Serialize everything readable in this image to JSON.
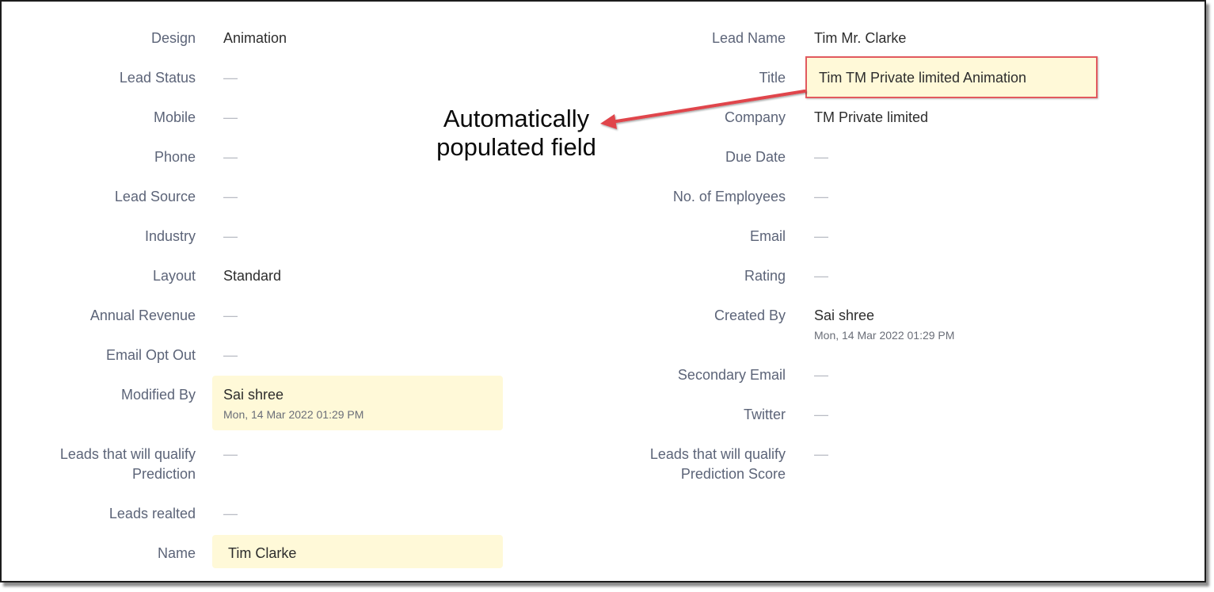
{
  "left_fields": [
    {
      "label": "Design",
      "value": "Animation"
    },
    {
      "label": "Lead Status",
      "value": "—"
    },
    {
      "label": "Mobile",
      "value": "—"
    },
    {
      "label": "Phone",
      "value": "—"
    },
    {
      "label": "Lead Source",
      "value": "—"
    },
    {
      "label": "Industry",
      "value": "—"
    },
    {
      "label": "Layout",
      "value": "Standard"
    },
    {
      "label": "Annual Revenue",
      "value": "—"
    },
    {
      "label": "Email Opt Out",
      "value": "—"
    },
    {
      "label": "Modified By",
      "value": "Sai shree",
      "sub": "Mon, 14 Mar 2022 01:29 PM"
    },
    {
      "label_line1": "Leads that will qualify",
      "label_line2": "Prediction",
      "value": "—"
    },
    {
      "label": "Leads realted",
      "value": "—"
    },
    {
      "label": "Name",
      "value": "Tim Clarke"
    }
  ],
  "right_fields": [
    {
      "label": "Lead Name",
      "value": "Tim Mr. Clarke"
    },
    {
      "label": "Title",
      "value": "Tim TM Private limited Animation"
    },
    {
      "label": "Company",
      "value": "TM Private limited"
    },
    {
      "label": "Due Date",
      "value": "—"
    },
    {
      "label": "No. of Employees",
      "value": "—"
    },
    {
      "label": "Email",
      "value": "—"
    },
    {
      "label": "Rating",
      "value": "—"
    },
    {
      "label": "Created By",
      "value": "Sai shree",
      "sub": "Mon, 14 Mar 2022 01:29 PM"
    },
    {
      "label": "Secondary Email",
      "value": "—"
    },
    {
      "label": "Twitter",
      "value": "—"
    },
    {
      "label_line1": "Leads that will qualify",
      "label_line2": "Prediction Score",
      "value": "—"
    }
  ],
  "annotation": {
    "line1": "Automatically",
    "line2": "populated field",
    "arrow_color": "#e0454b"
  },
  "colors": {
    "highlight": "#fff9d8",
    "highlight_border": "#e25a5f",
    "label": "#5c6478",
    "value": "#2d2d2d"
  }
}
